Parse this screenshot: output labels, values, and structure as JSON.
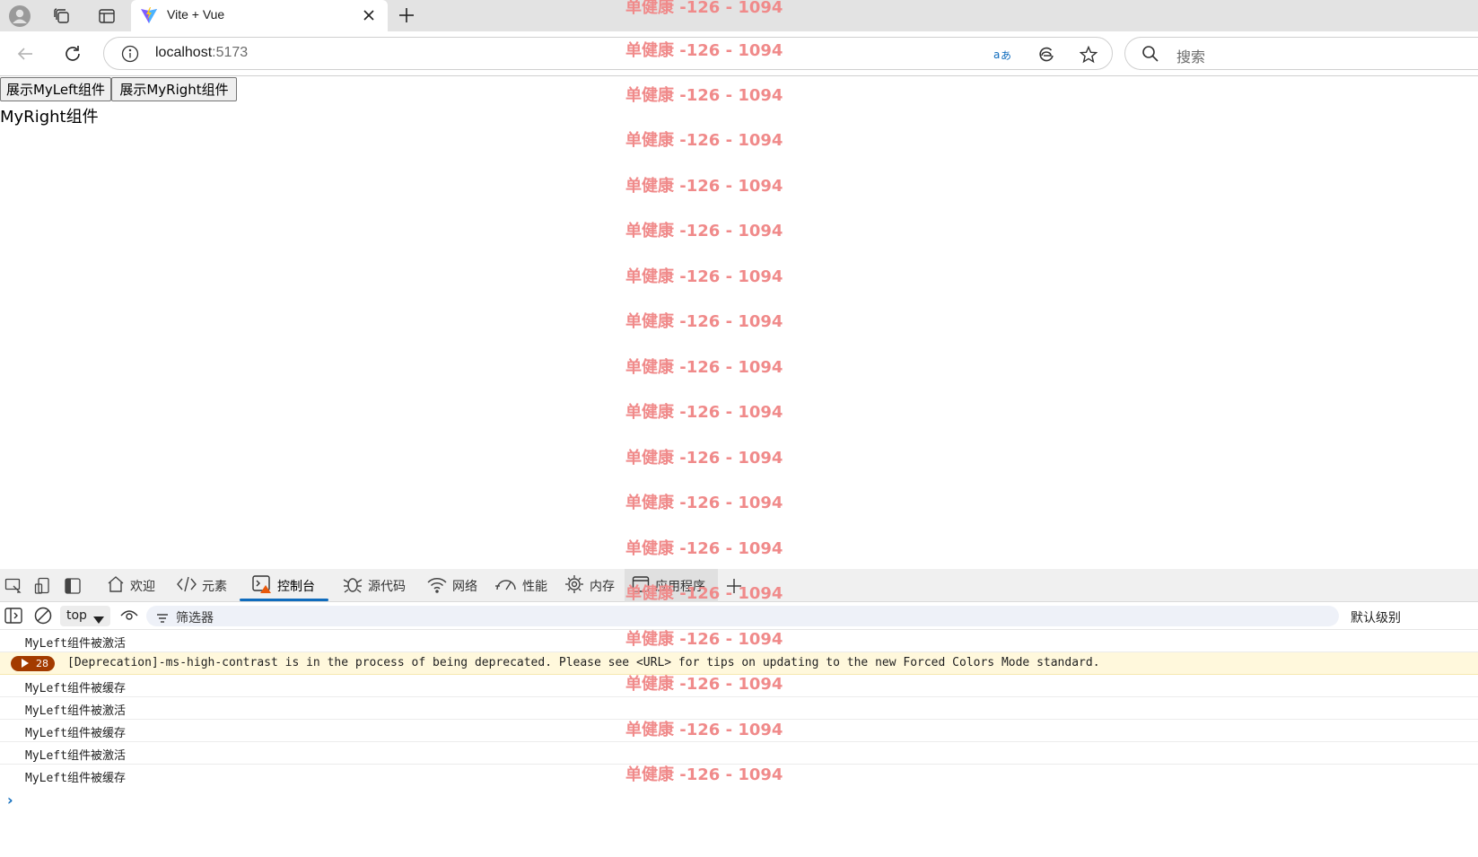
{
  "browser": {
    "tab_title": "Vite + Vue",
    "url_host": "localhost",
    "url_port": ":5173",
    "search_placeholder": "搜索",
    "icons": [
      "profile-icon",
      "collections-icon",
      "tab-actions-icon",
      "vite-favicon",
      "close-icon",
      "plus-icon",
      "back-icon",
      "refresh-icon",
      "site-info-icon",
      "translate-icon",
      "edge-icon",
      "favorite-star-icon",
      "search-icon"
    ]
  },
  "page": {
    "buttons": [
      "展示MyLeft组件",
      "展示MyRight组件"
    ],
    "component_text": "MyRight组件"
  },
  "watermark": {
    "text": "单健康 -126 - 1094",
    "color": "#f08a8a"
  },
  "devtools": {
    "tabs": [
      "欢迎",
      "元素",
      "控制台",
      "源代码",
      "网络",
      "性能",
      "内存",
      "应用程序"
    ],
    "active_tab": "控制台",
    "context": "top",
    "filter_placeholder": "筛选器",
    "level": "默认级别",
    "accent": "#0f6cbd",
    "logs": [
      {
        "text": "MyLeft组件被激活"
      },
      {
        "text": "[Deprecation]-ms-high-contrast is in the process of being deprecated. Please see <URL> for tips on updating to the new Forced Colors Mode standard.",
        "count": "28",
        "level": "warning"
      },
      {
        "text": "MyLeft组件被缓存"
      },
      {
        "text": "MyLeft组件被激活"
      },
      {
        "text": "MyLeft组件被缓存"
      },
      {
        "text": "MyLeft组件被激活"
      },
      {
        "text": "MyLeft组件被缓存"
      }
    ],
    "prompt": "›"
  }
}
